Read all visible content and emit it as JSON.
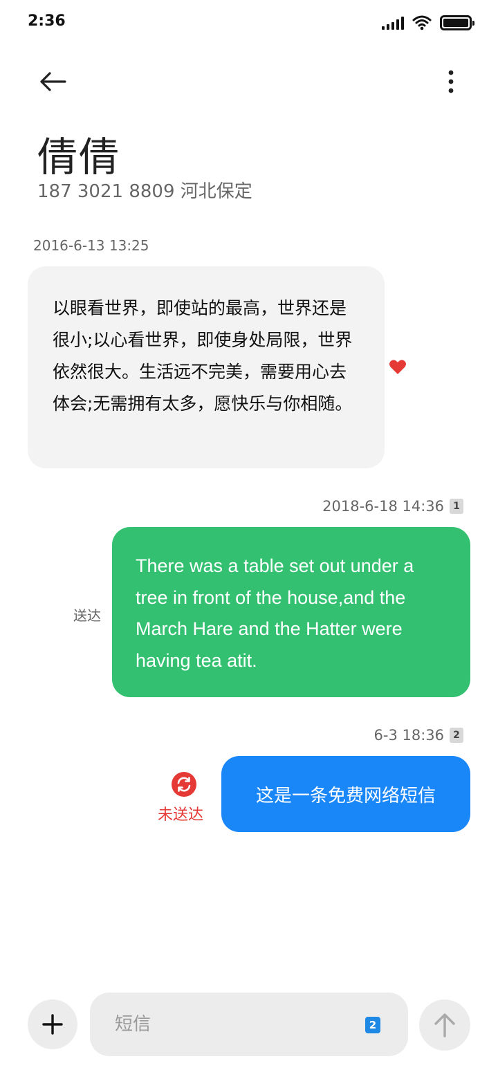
{
  "status_bar": {
    "time": "2:36",
    "icons": [
      "signal-icon",
      "wifi-icon",
      "battery-icon"
    ]
  },
  "nav": {
    "back_icon": "arrow-left-icon",
    "more_icon": "more-vertical-icon"
  },
  "contact": {
    "name": "倩倩",
    "subtitle": "187 3021 8809 河北保定"
  },
  "messages": [
    {
      "direction": "incoming",
      "timestamp": "2016-6-13 13:25",
      "text": "以眼看世界，即使站的最高，世界还是很小;以心看世界，即使身处局限，世界依然很大。生活远不完美，需要用心去体会;无需拥有太多，愿快乐与你相随。",
      "favorite_icon": "heart-icon",
      "favorite_color": "#e53935"
    },
    {
      "direction": "outgoing",
      "timestamp": "2018-6-18 14:36",
      "sim": "1",
      "text": "There was a table set out under a tree in front of the house,and the March Hare and the Hatter were having tea atit.",
      "status": "送达",
      "color": "#33c071"
    },
    {
      "direction": "outgoing",
      "timestamp": "6-3 18:36",
      "sim": "2",
      "text": "这是一条免费网络短信",
      "status": "未送达",
      "status_icon": "resend-icon",
      "status_color": "#e53935",
      "color": "#1987f8"
    }
  ],
  "composer": {
    "add_icon": "plus-icon",
    "placeholder": "短信",
    "value": "",
    "sim": "2",
    "send_icon": "arrow-up-icon"
  }
}
